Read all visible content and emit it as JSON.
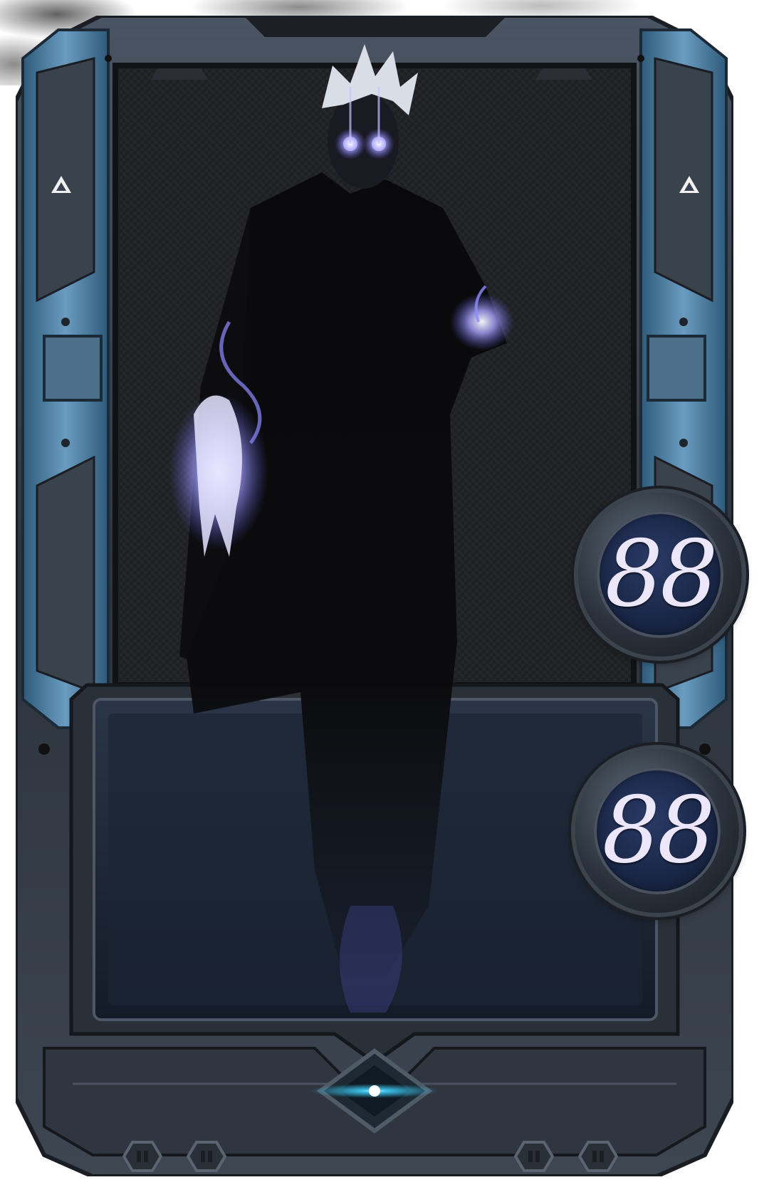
{
  "card": {
    "attack": "88",
    "health": "88",
    "icons": {
      "left_rank": "triangle-icon",
      "right_rank": "triangle-icon",
      "gem": "diamond-gem-icon",
      "slots": [
        "hex-slot-icon",
        "hex-slot-icon",
        "hex-slot-icon",
        "hex-slot-icon"
      ]
    },
    "colors": {
      "frame_steel": "#3c4552",
      "frame_blue": "#4b7fa3",
      "art_bg": "#1e1f22",
      "text_panel": "#1c2534",
      "stat_text": "#ebe6fa",
      "glow": "#8d8cff",
      "gem_glow": "#3fd2ff"
    }
  }
}
